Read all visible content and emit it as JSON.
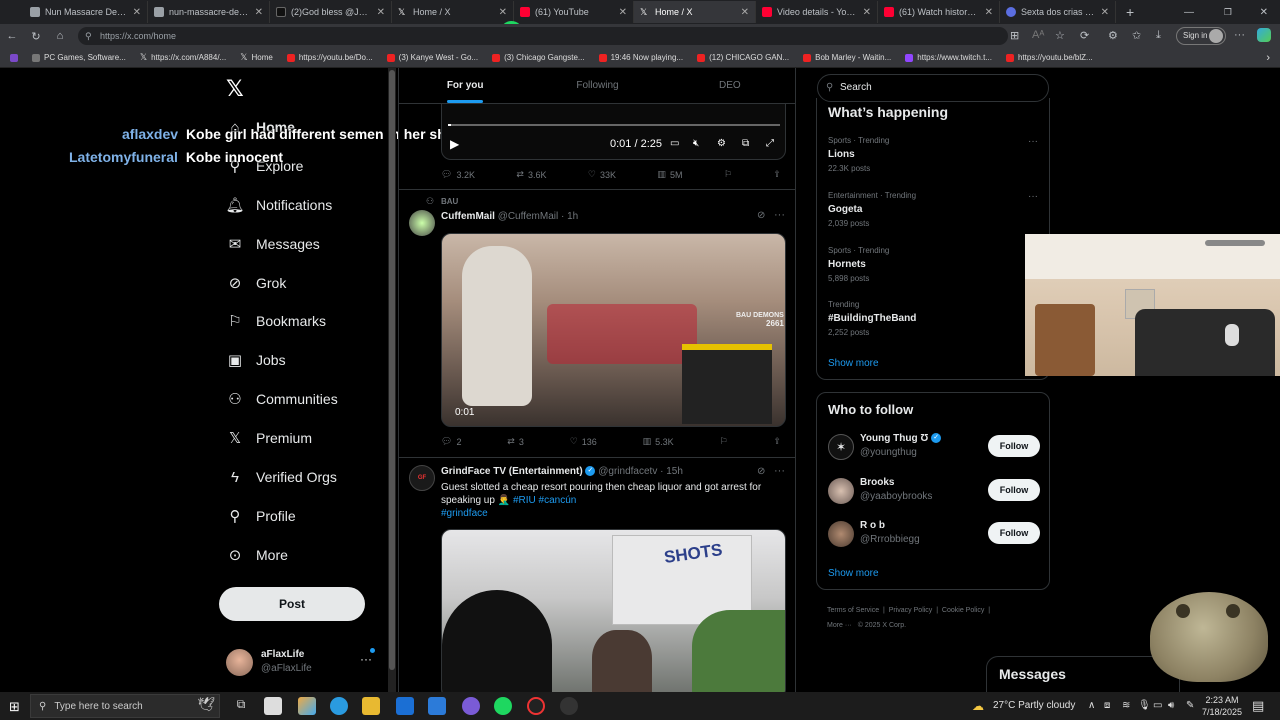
{
  "browser": {
    "tabs": [
      {
        "title": "Nun Massacre Definiti",
        "icon": "page-icon",
        "color": "#9aa0a6"
      },
      {
        "title": "nun-massacre-definiti",
        "icon": "page-icon",
        "color": "#9aa0a6"
      },
      {
        "title": "(2)God bless @Joshua",
        "icon": "tiktok-icon",
        "color": "#111111"
      },
      {
        "title": "Home / X",
        "icon": "x-icon",
        "color": "#ffffff"
      },
      {
        "title": "(61) YouTube",
        "icon": "youtube-icon",
        "color": "#ff0033"
      },
      {
        "title": "Home / X",
        "icon": "x-icon",
        "color": "#ffffff"
      },
      {
        "title": "Video details - YouTub",
        "icon": "youtube-icon",
        "color": "#ff0033"
      },
      {
        "title": "(61) Watch history - Yo",
        "icon": "youtube-icon",
        "color": "#ff0033"
      },
      {
        "title": "Sexta dos crias - D",
        "icon": "tiktok-icon",
        "color": "#5b6ee1"
      }
    ],
    "new_tab": "+",
    "url_placeholder": "https://x.com/home",
    "url": "https://x.com/home",
    "signin_label": "Sign in",
    "bookmarks": [
      "PC Games, Software...",
      "https://x.com/A884/...",
      "Home",
      "https://youtu.be/Do...",
      "(3) Kanye West - Go...",
      "(3) Chicago Gangste...",
      "19:46 Now playing...",
      "(12) CHICAGO GAN...",
      "Bob Marley - Waitin...",
      "https://www.twitch.t...",
      "https://youtu.be/blZ..."
    ]
  },
  "sidebar": {
    "items": [
      {
        "label": "Home",
        "icon": "home-icon"
      },
      {
        "label": "Explore",
        "icon": "search-icon"
      },
      {
        "label": "Notifications",
        "icon": "bell-icon"
      },
      {
        "label": "Messages",
        "icon": "mail-icon"
      },
      {
        "label": "Grok",
        "icon": "grok-icon"
      },
      {
        "label": "Bookmarks",
        "icon": "bookmark-icon"
      },
      {
        "label": "Jobs",
        "icon": "briefcase-icon"
      },
      {
        "label": "Communities",
        "icon": "people-icon"
      },
      {
        "label": "Premium",
        "icon": "x-icon"
      },
      {
        "label": "Verified Orgs",
        "icon": "lightning-icon"
      },
      {
        "label": "Profile",
        "icon": "person-icon"
      },
      {
        "label": "More",
        "icon": "more-circle-icon"
      }
    ],
    "post_label": "Post",
    "account": {
      "name": "aFlaxLife",
      "handle": "@aFlaxLife"
    }
  },
  "feed": {
    "tabs": [
      "For you",
      "Following",
      "DEO"
    ],
    "video1": {
      "time": "0:01 / 2:25"
    },
    "post1_stats": {
      "replies": "3.2K",
      "reposts": "3.6K",
      "likes": "33K",
      "views": "5M"
    },
    "post2": {
      "context": "BAU",
      "name": "CuffemMail",
      "handle": "@CuffemMail",
      "time": "· 1h",
      "video_time": "0:01",
      "watermark": "BAU DEMONS",
      "watermark2": "2661",
      "stats": {
        "replies": "2",
        "reposts": "3",
        "likes": "136",
        "views": "5.3K"
      }
    },
    "post3": {
      "name": "GrindFace TV (Entertainment)",
      "handle": "@grindfacetv",
      "time": "· 15h",
      "text": "Guest slotted a cheap resort pouring then cheap liquor and got arrest for speaking up 🤦‍♂️",
      "hashtags": "#RIU #cancún",
      "hashtag2": "#grindface",
      "media_sign": "SHOTS"
    }
  },
  "right": {
    "search_placeholder": "Search",
    "whats_happening": "What’s happening",
    "trends": [
      {
        "category": "Sports · Trending",
        "name": "Lions",
        "count": "22.3K posts"
      },
      {
        "category": "Entertainment · Trending",
        "name": "Gogeta",
        "count": "2,039 posts"
      },
      {
        "category": "Sports · Trending",
        "name": "Hornets",
        "count": "5,898 posts"
      },
      {
        "category": "Trending",
        "name": "#BuildingTheBand",
        "count": "2,252 posts"
      }
    ],
    "show_more": "Show more",
    "who_to_follow": "Who to follow",
    "follow_list": [
      {
        "name": "Young Thug Ʊ",
        "handle": "@youngthug",
        "verified": true
      },
      {
        "name": "Brooks",
        "handle": "@yaaboybrooks",
        "verified": false
      },
      {
        "name": "R o b",
        "handle": "@Rrrobbiegg",
        "verified": false
      }
    ],
    "follow_label": "Follow",
    "show_more2": "Show more",
    "footer": [
      "Terms of Service",
      "Privacy Policy",
      "Cookie Policy",
      "More ···",
      "© 2025 X Corp."
    ],
    "messages_label": "Messages"
  },
  "stream_overlay": {
    "chat": [
      {
        "user": "aflaxdev",
        "message": "Kobe girl had different semen in her she lying"
      },
      {
        "user": "Latetomyfuneral",
        "message": "Kobe innocent"
      }
    ]
  },
  "taskbar": {
    "search_placeholder": "Type here to search",
    "weather": "27°C  Partly cloudy",
    "time": "2:23 AM",
    "date": "7/18/2025"
  },
  "colors": {
    "accent": "#1d9bf0",
    "background": "#000000",
    "border": "#2f3336"
  }
}
